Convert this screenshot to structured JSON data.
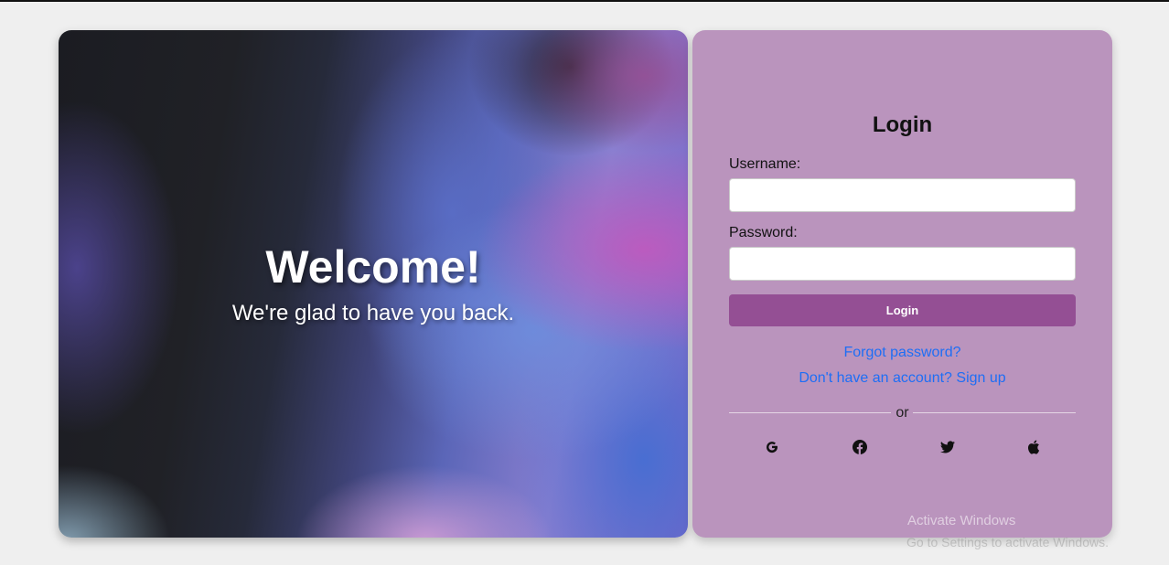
{
  "hero": {
    "title": "Welcome!",
    "subtitle": "We're glad to have you back."
  },
  "login": {
    "title": "Login",
    "username_label": "Username:",
    "username_value": "",
    "password_label": "Password:",
    "password_value": "",
    "submit_label": "Login",
    "forgot_link": "Forgot password?",
    "signup_link": "Don't have an account? Sign up",
    "divider_text": "or",
    "social_icons": [
      "google-icon",
      "facebook-icon",
      "twitter-icon",
      "apple-icon"
    ]
  },
  "watermark": {
    "line1": "Activate Windows",
    "line2": "Go to Settings to activate Windows."
  },
  "colors": {
    "page_bg": "#efefef",
    "card_bg": "#ba94bd",
    "button_bg": "#944f94",
    "link": "#1e6ef5"
  }
}
